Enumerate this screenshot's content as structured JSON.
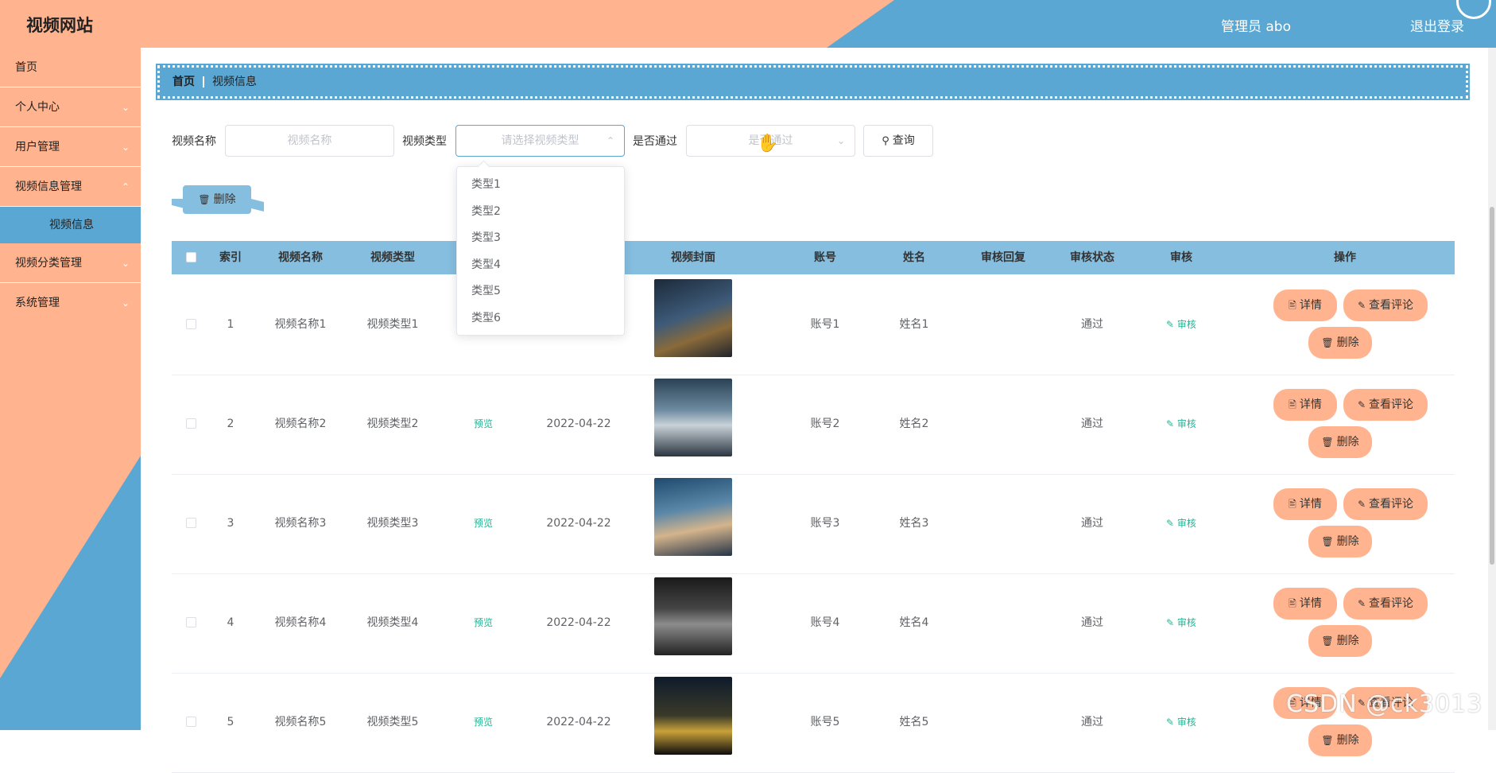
{
  "colors": {
    "accent_peach": "#ffb48f",
    "accent_blue": "#5aa7d3",
    "table_head": "#86bedf",
    "link_green": "#26b393"
  },
  "header": {
    "title": "视频网站",
    "admin": "管理员 abo",
    "logout": "退出登录"
  },
  "sidebar": {
    "items": [
      {
        "label": "首页"
      },
      {
        "label": "个人中心"
      },
      {
        "label": "用户管理"
      },
      {
        "label": "视频信息管理"
      }
    ],
    "submenu": {
      "label": "视频信息"
    },
    "items_after": [
      {
        "label": "视频分类管理"
      },
      {
        "label": "系统管理"
      }
    ]
  },
  "breadcrumb": {
    "home": "首页",
    "current": "视频信息"
  },
  "search": {
    "name_label": "视频名称",
    "name_placeholder": "视频名称",
    "type_label": "视频类型",
    "type_placeholder": "请选择视频类型",
    "pass_label": "是否通过",
    "pass_placeholder": "是否通过",
    "query_button": "查询"
  },
  "dropdown": {
    "options": [
      "类型1",
      "类型2",
      "类型3",
      "类型4",
      "类型5",
      "类型6"
    ]
  },
  "actions": {
    "batch_delete": "删除"
  },
  "table": {
    "headers": [
      "索引",
      "视频名称",
      "视频类型",
      "",
      "",
      "视频封面",
      "账号",
      "姓名",
      "审核回复",
      "审核状态",
      "审核",
      "操作"
    ],
    "rows": [
      {
        "index": "1",
        "name": "视频名称1",
        "type": "视频类型1",
        "preview": "",
        "date": "",
        "account": "账号1",
        "person": "姓名1",
        "reply": "",
        "status": "通过",
        "audit": "审核"
      },
      {
        "index": "2",
        "name": "视频名称2",
        "type": "视频类型2",
        "preview": "预览",
        "date": "2022-04-22",
        "account": "账号2",
        "person": "姓名2",
        "reply": "",
        "status": "通过",
        "audit": "审核"
      },
      {
        "index": "3",
        "name": "视频名称3",
        "type": "视频类型3",
        "preview": "预览",
        "date": "2022-04-22",
        "account": "账号3",
        "person": "姓名3",
        "reply": "",
        "status": "通过",
        "audit": "审核"
      },
      {
        "index": "4",
        "name": "视频名称4",
        "type": "视频类型4",
        "preview": "预览",
        "date": "2022-04-22",
        "account": "账号4",
        "person": "姓名4",
        "reply": "",
        "status": "通过",
        "audit": "审核"
      },
      {
        "index": "5",
        "name": "视频名称5",
        "type": "视频类型5",
        "preview": "预览",
        "date": "2022-04-22",
        "account": "账号5",
        "person": "姓名5",
        "reply": "",
        "status": "通过",
        "audit": "审核"
      }
    ],
    "op_labels": {
      "detail": "详情",
      "comments": "查看评论",
      "delete": "删除"
    }
  },
  "watermark": "CSDN @ck3013"
}
